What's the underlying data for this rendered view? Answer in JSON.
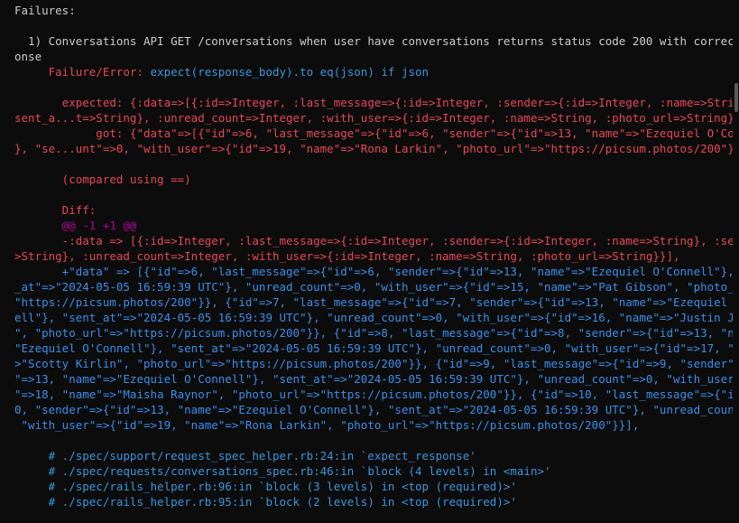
{
  "lines": [
    {
      "id": "failures",
      "text": "Failures:"
    },
    {
      "id": "failure-title-1",
      "text": "  1) Conversations API GET /conversations when user have conversations returns status code 200 with correct resp"
    },
    {
      "id": "failure-title-2",
      "text": "onse"
    },
    {
      "id": "failure-error-label",
      "text": "     Failure/Error: "
    },
    {
      "id": "failure-error-code",
      "text": "expect(response_body).to eq(json) if json"
    },
    {
      "id": "expected-1",
      "text": "       expected: {:data=>[{:id=>Integer, :last_message=>{:id=>Integer, :sender=>{:id=>Integer, :name=>String}, :"
    },
    {
      "id": "expected-2",
      "text": "sent_a...t=>String}, :unread_count=>Integer, :with_user=>{:id=>Integer, :name=>String, :photo_url=>String}}]}"
    },
    {
      "id": "got-1",
      "text": "            got: {\"data\"=>[{\"id\"=>6, \"last_message\"=>{\"id\"=>6, \"sender\"=>{\"id\"=>13, \"name\"=>\"Ezequiel O'Connell\""
    },
    {
      "id": "got-2",
      "text": "}, \"se...unt\"=>0, \"with_user\"=>{\"id\"=>19, \"name\"=>\"Rona Larkin\", \"photo_url\"=>\"https://picsum.photos/200\"}}]}"
    },
    {
      "id": "compared",
      "text": "       (compared using ==)"
    },
    {
      "id": "diff-label",
      "text": "       Diff:"
    },
    {
      "id": "hunk",
      "text": "       @@ -1 +1 @@"
    },
    {
      "id": "minus-1",
      "text": "       -:data => [{:id=>Integer, :last_message=>{:id=>Integer, :sender=>{:id=>Integer, :name=>String}, :sent_at="
    },
    {
      "id": "minus-2",
      "text": ">String}, :unread_count=>Integer, :with_user=>{:id=>Integer, :name=>String, :photo_url=>String}}],"
    },
    {
      "id": "plus-1",
      "text": "       +\"data\" => [{\"id\"=>6, \"last_message\"=>{\"id\"=>6, \"sender\"=>{\"id\"=>13, \"name\"=>\"Ezequiel O'Connell\"}, \"sent"
    },
    {
      "id": "plus-2",
      "text": "_at\"=>\"2024-05-05 16:59:39 UTC\"}, \"unread_count\"=>0, \"with_user\"=>{\"id\"=>15, \"name\"=>\"Pat Gibson\", \"photo_url\"=>"
    },
    {
      "id": "plus-3",
      "text": "\"https://picsum.photos/200\"}}, {\"id\"=>7, \"last_message\"=>{\"id\"=>7, \"sender\"=>{\"id\"=>13, \"name\"=>\"Ezequiel O'Conn"
    },
    {
      "id": "plus-4",
      "text": "ell\"}, \"sent_at\"=>\"2024-05-05 16:59:39 UTC\"}, \"unread_count\"=>0, \"with_user\"=>{\"id\"=>16, \"name\"=>\"Justin Johnson"
    },
    {
      "id": "plus-5",
      "text": "\", \"photo_url\"=>\"https://picsum.photos/200\"}}, {\"id\"=>8, \"last_message\"=>{\"id\"=>8, \"sender\"=>{\"id\"=>13, \"name\"=>"
    },
    {
      "id": "plus-6",
      "text": "\"Ezequiel O'Connell\"}, \"sent_at\"=>\"2024-05-05 16:59:39 UTC\"}, \"unread_count\"=>0, \"with_user\"=>{\"id\"=>17, \"name\"="
    },
    {
      "id": "plus-7",
      "text": ">\"Scotty Kirlin\", \"photo_url\"=>\"https://picsum.photos/200\"}}, {\"id\"=>9, \"last_message\"=>{\"id\"=>9, \"sender\"=>{\"id"
    },
    {
      "id": "plus-8",
      "text": "\"=>13, \"name\"=>\"Ezequiel O'Connell\"}, \"sent_at\"=>\"2024-05-05 16:59:39 UTC\"}, \"unread_count\"=>0, \"with_user\"=>{\"id"
    },
    {
      "id": "plus-9",
      "text": "\"=>18, \"name\"=>\"Maisha Raynor\", \"photo_url\"=>\"https://picsum.photos/200\"}}, {\"id\"=>10, \"last_message\"=>{\"id\"=>1"
    },
    {
      "id": "plus-10",
      "text": "0, \"sender\"=>{\"id\"=>13, \"name\"=>\"Ezequiel O'Connell\"}, \"sent_at\"=>\"2024-05-05 16:59:39 UTC\"}, \"unread_count\"=>0,"
    },
    {
      "id": "plus-11",
      "text": " \"with_user\"=>{\"id\"=>19, \"name\"=>\"Rona Larkin\", \"photo_url\"=>\"https://picsum.photos/200\"}}],"
    },
    {
      "id": "trace-1",
      "text": "     # ./spec/support/request_spec_helper.rb:24:in `expect_response'"
    },
    {
      "id": "trace-2",
      "text": "     # ./spec/requests/conversations_spec.rb:46:in `block (4 levels) in <main>'"
    },
    {
      "id": "trace-3",
      "text": "     # ./spec/rails_helper.rb:96:in `block (3 levels) in <top (required)>'"
    },
    {
      "id": "trace-4",
      "text": "     # ./spec/rails_helper.rb:95:in `block (2 levels) in <top (required)>'"
    }
  ],
  "colors": {
    "background": "#0c0c0c",
    "default": "#cccccc",
    "error": "#e74856",
    "added": "#3b8eea",
    "trace": "#3a96dd",
    "hunk": "#b4009e"
  }
}
